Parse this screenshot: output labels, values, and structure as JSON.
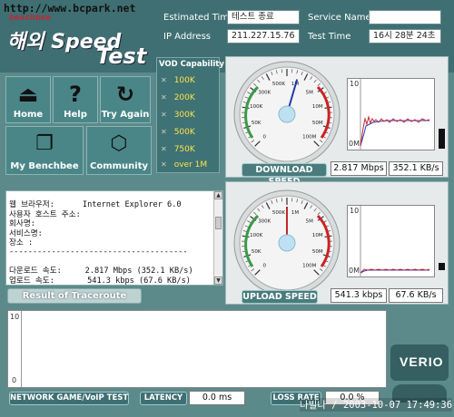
{
  "header": {
    "watermark": "http://www.bcpark.net",
    "logo": "benchbee",
    "title_line1": "해외 Speed",
    "title_line2": "Test",
    "estimated_time_label": "Estimated Time",
    "estimated_time_value": "테스트 종료",
    "service_name_label": "Service Name",
    "service_name_value": "",
    "ip_label": "IP Address",
    "ip_value": "211.227.15.76",
    "test_time_label": "Test Time",
    "test_time_value": "16시 28분 24초"
  },
  "nav": {
    "home": "Home",
    "help": "Help",
    "try_again": "Try Again",
    "my_benchbee": "My Benchbee",
    "community": "Community"
  },
  "vod": {
    "title": "VOD Capability",
    "items": [
      "100K",
      "200K",
      "300K",
      "500K",
      "750K",
      "over 1M"
    ]
  },
  "download": {
    "label": "DOWNLOAD SPEED",
    "mbps": "2.817 Mbps",
    "kbs": "352.1 KB/s",
    "needle_fraction": 0.56,
    "graph_top": "10",
    "graph_bottom": "0M"
  },
  "upload": {
    "label": "UPLOAD SPEED",
    "kbps": "541.3 kbps",
    "kbs": "67.6 KB/s",
    "needle_fraction": 0.5,
    "graph_top": "10",
    "graph_bottom": "0M"
  },
  "gauge_ticks": [
    "0",
    "50K",
    "100K",
    "300K",
    "500K",
    "1M",
    "5M",
    "10M",
    "50M",
    "100M"
  ],
  "report": {
    "lines": [
      "웹 브라우저:      Internet Explorer 6.0",
      "사용자 호스트 주소:",
      "회사명:",
      "서비스명:",
      "장소 :",
      "--------------------------------------",
      "",
      "다운로드 속도:     2.817 Mbps (352.1 KB/s)",
      "업로드 속도:       541.3 kbps (67.6 KB/s)"
    ]
  },
  "trace_button": "Result of Traceroute",
  "bottom": {
    "graph_top": "10",
    "graph_bottom": "0",
    "game_label": "NETWORK GAME/VoIP TEST",
    "latency_label": "LATENCY",
    "latency_value": "0.0 ms",
    "loss_label": "LOSS RATE",
    "loss_value": "0.0 %",
    "verio": "VERIO",
    "stamp": "나빌나 / 2003-10-07 17:49:36"
  },
  "colors": {
    "background": "#5c8a8b",
    "header": "#3f6f72",
    "vod_text": "#ffe14b",
    "download_line": "#c0282e",
    "upload_line": "#c0282e"
  }
}
